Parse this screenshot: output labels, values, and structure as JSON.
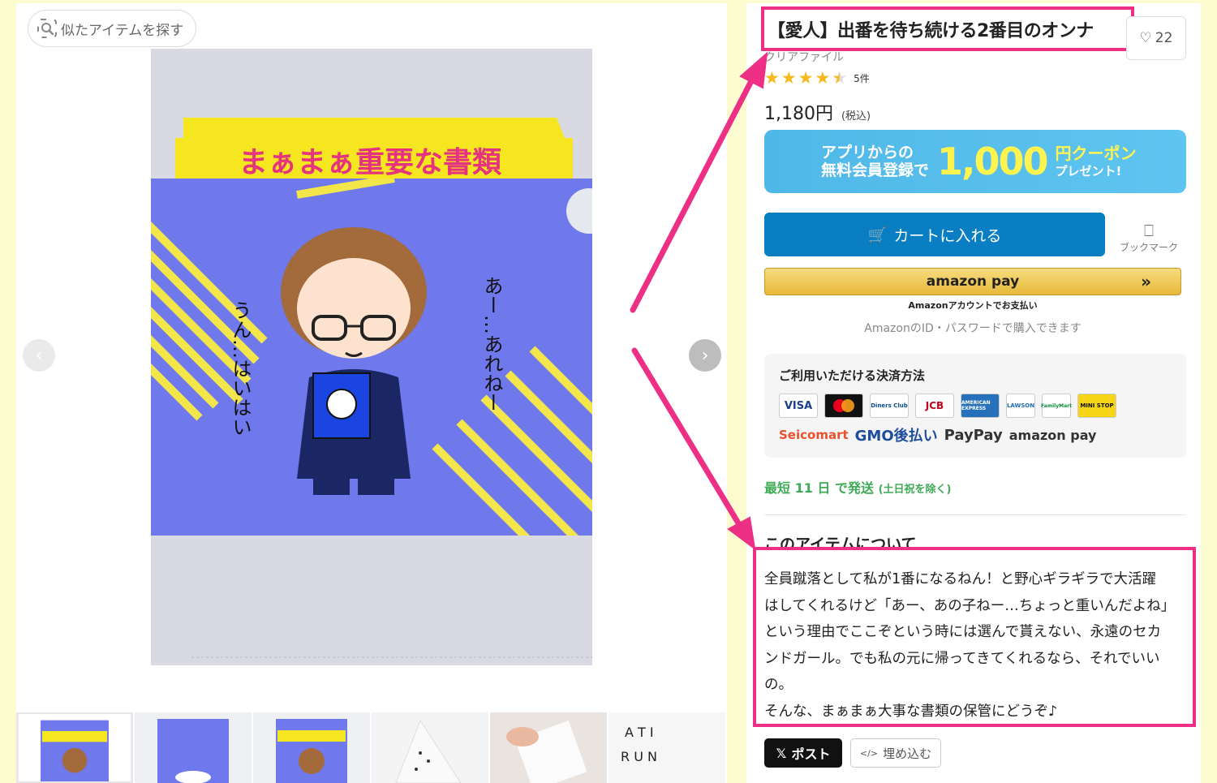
{
  "left": {
    "similar_label": "似たアイテムを探す",
    "product_image_texts": {
      "banner": "まぁまぁ重要な書類",
      "speech_left": "うん…はいはい",
      "speech_right": "あー…あれねー"
    },
    "thumbnails": [
      "thumb-1",
      "thumb-2",
      "thumb-3",
      "thumb-4",
      "thumb-5",
      "thumb-6"
    ]
  },
  "product": {
    "title": "【愛人】出番を待ち続ける2番目のオンナ",
    "favorite_count": "22",
    "category": "クリアファイル",
    "rating": 4.5,
    "review_count": "5件",
    "price": "1,180円",
    "tax_note": "(税込)"
  },
  "banner": {
    "line1": "アプリからの",
    "line2": "無料会員登録で",
    "amount": "1,000",
    "unit": "円クーポン",
    "present": "プレゼント!"
  },
  "actions": {
    "cart_label": "カートに入れる",
    "bookmark_label": "ブックマーク",
    "amazon_pay_label": "amazon pay",
    "amazon_sub": "Amazonアカウントでお支払い",
    "amazon_note": "AmazonのID・パスワードで購入できます"
  },
  "payment": {
    "title": "ご利用いただける決済方法",
    "cards": [
      "VISA",
      "mastercard",
      "Diners Club",
      "JCB",
      "AMERICAN EXPRESS",
      "LAWSON",
      "FamilyMart",
      "MINI STOP"
    ],
    "providers": [
      "Seicomart",
      "GMO後払い",
      "PayPay",
      "amazon pay"
    ]
  },
  "shipping": {
    "text": "最短 11 日 で発送",
    "note": "(土日祝を除く)"
  },
  "about": {
    "title": "このアイテムについて",
    "lines": [
      "全員蹴落として私が1番になるねん！と野心ギラギラで大活躍",
      "はしてくれるけど「あー、あの子ねー…ちょっと重いんだよね」",
      "という理由でここぞという時には選んで貰えない、永遠のセカ",
      "ンドガール。でも私の元に帰ってきてくれるなら、それでいい",
      "の。",
      "そんな、まぁまぁ大事な書類の保管にどうぞ♪"
    ]
  },
  "share": {
    "post_label": "ポスト",
    "embed_label": "埋め込む"
  },
  "colors": {
    "highlight": "#ee2f86",
    "cart_blue": "#0a7ec2",
    "shipping_green": "#3eab57",
    "star": "#f6b91b"
  }
}
